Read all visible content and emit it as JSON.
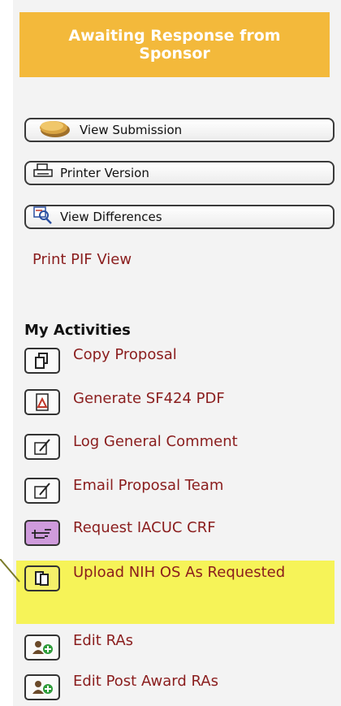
{
  "status_banner": {
    "text": "Awaiting Response from Sponsor",
    "color": "#f3b93b"
  },
  "buttons": [
    {
      "label": "View Submission",
      "icon": "coin-stack-icon"
    },
    {
      "label": "Printer Version",
      "icon": "printer-icon"
    },
    {
      "label": "View Differences",
      "icon": "compare-magnifier-icon"
    }
  ],
  "print_pif": "Print PIF View",
  "activities": {
    "heading": "My Activities",
    "items": [
      {
        "label": "Copy Proposal",
        "icon": "copy-icon"
      },
      {
        "label": "Generate SF424 PDF",
        "icon": "pdf-icon"
      },
      {
        "label": "Log General Comment",
        "icon": "comment-pencil-icon"
      },
      {
        "label": "Email Proposal Team",
        "icon": "comment-pencil-icon"
      },
      {
        "label": "Request IACUC CRF",
        "icon": "pointing-hand-icon"
      },
      {
        "label": "Upload NIH OS As Requested",
        "icon": "document-stack-icon",
        "highlighted": true
      },
      {
        "label": "Edit RAs",
        "icon": "add-user-icon"
      },
      {
        "label": "Edit Post Award RAs",
        "icon": "add-user-icon"
      }
    ]
  },
  "colors": {
    "link": "#8a1d1d",
    "highlight": "#f6f358"
  }
}
